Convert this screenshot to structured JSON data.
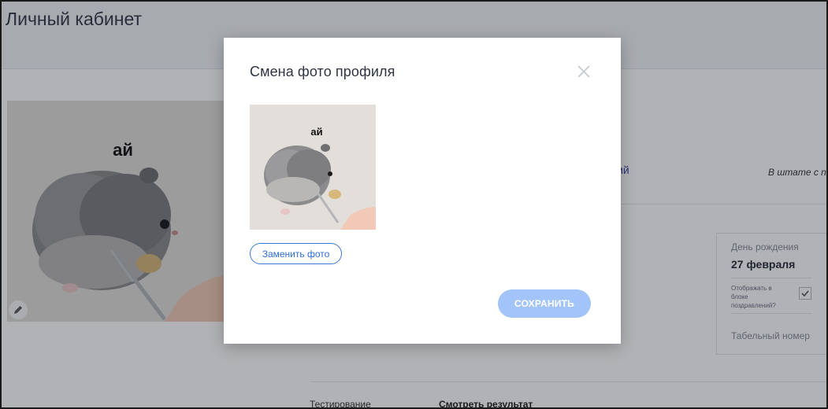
{
  "page": {
    "title": "Личный кабинет",
    "link_fragment": "гий",
    "staff_text": "В штате с null",
    "photo_caption": "ай",
    "birthday": {
      "label": "День рождения",
      "value": "27 февраля",
      "show_in_block": "Отображать в блоке поздравлений?",
      "checked": true
    },
    "tab_number_label": "Табельный номер",
    "testing_label": "Тестирование",
    "results_link": "Смотреть результат"
  },
  "modal": {
    "title": "Смена фото профиля",
    "photo_caption": "ай",
    "replace_photo_label": "Заменить фото",
    "save_label": "СОХРАНИТЬ"
  },
  "colors": {
    "accent_blue": "#2e6fd6",
    "save_button_disabled": "#a3c4f8",
    "overlay": "rgba(16,20,30,0.33)"
  },
  "icons": {
    "close": "close-icon",
    "edit": "pencil-icon",
    "check": "checkmark-icon"
  }
}
